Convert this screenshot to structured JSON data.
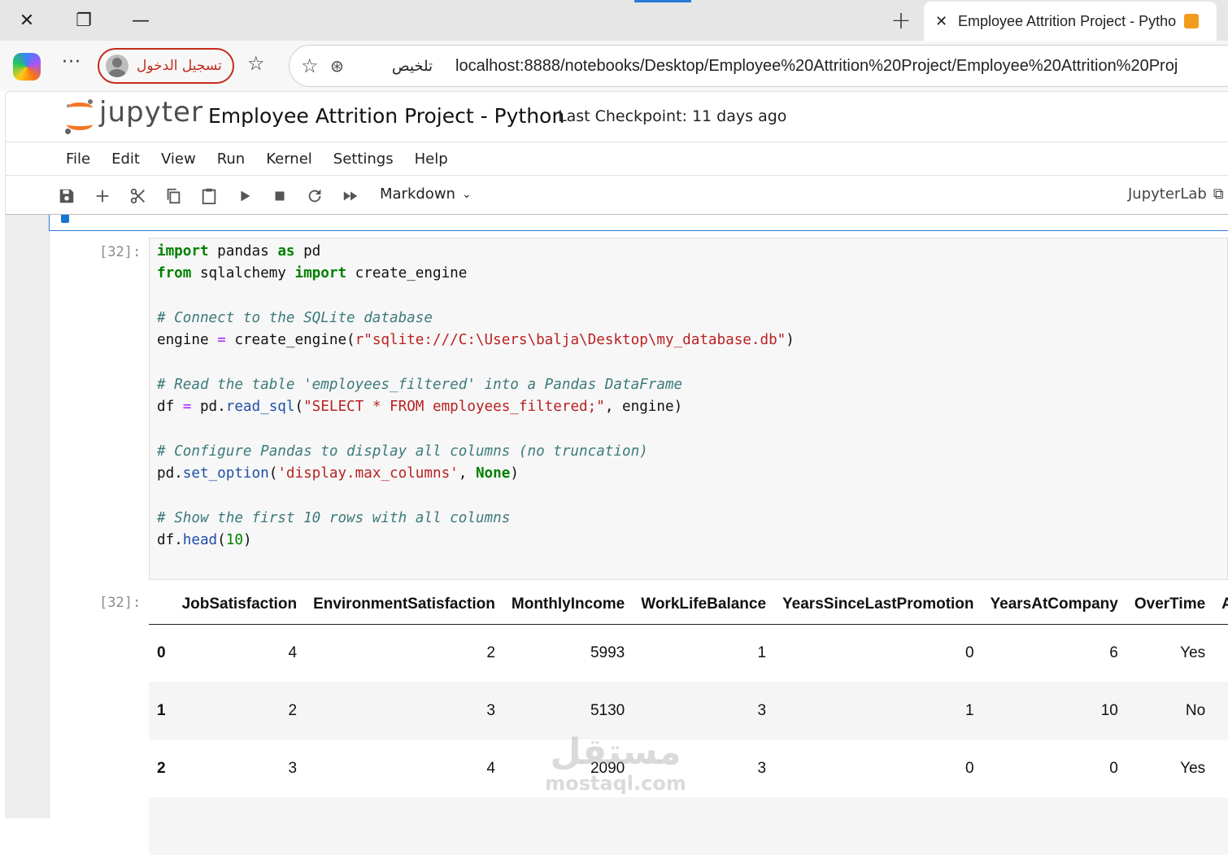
{
  "browser": {
    "close_glyph": "✕",
    "restore_glyph": "❐",
    "minimize_glyph": "—",
    "new_tab_glyph": "+",
    "tab": {
      "close_glyph": "✕",
      "title": "Employee Attrition Project - Pytho"
    },
    "more_glyph": "···",
    "profile_label": "تسجيل الدخول",
    "favorites_glyph": "☆",
    "address": {
      "star_glyph": "☆",
      "summarize_glyph": "⊛",
      "summarize_label": "تلخيص",
      "url": "localhost:8888/notebooks/Desktop/Employee%20Attrition%20Project/Employee%20Attrition%20Proj"
    }
  },
  "jupyter": {
    "wordmark": "jupyter",
    "notebook_title": "Employee Attrition Project - Python",
    "checkpoint": "Last Checkpoint: 11 days ago",
    "menu": [
      "File",
      "Edit",
      "View",
      "Run",
      "Kernel",
      "Settings",
      "Help"
    ],
    "toolbar": {
      "cell_type": "Markdown",
      "cell_type_chevron": "⌄",
      "jupyterlab_label": "JupyterLab",
      "external_glyph": "⧉"
    }
  },
  "cells": {
    "input_prompt": "[32]:",
    "output_prompt": "[32]:",
    "code_lines": [
      "import pandas as pd",
      "from sqlalchemy import create_engine",
      "",
      "# Connect to the SQLite database",
      "engine = create_engine(r\"sqlite:///C:\\Users\\balja\\Desktop\\my_database.db\")",
      "",
      "# Read the table 'employees_filtered' into a Pandas DataFrame",
      "df = pd.read_sql(\"SELECT * FROM employees_filtered;\", engine)",
      "",
      "# Configure Pandas to display all columns (no truncation)",
      "pd.set_option('display.max_columns', None)",
      "",
      "# Show the first 10 rows with all columns",
      "df.head(10)"
    ]
  },
  "dataframe": {
    "columns": [
      "",
      "JobSatisfaction",
      "EnvironmentSatisfaction",
      "MonthlyIncome",
      "WorkLifeBalance",
      "YearsSinceLastPromotion",
      "YearsAtCompany",
      "OverTime",
      "A"
    ],
    "rows": [
      [
        "0",
        "4",
        "2",
        "5993",
        "1",
        "0",
        "6",
        "Yes",
        ""
      ],
      [
        "1",
        "2",
        "3",
        "5130",
        "3",
        "1",
        "10",
        "No",
        ""
      ],
      [
        "2",
        "3",
        "4",
        "2090",
        "3",
        "0",
        "0",
        "Yes",
        ""
      ]
    ]
  },
  "watermark": {
    "arabic": "مستقل",
    "latin": "mostaql.com"
  }
}
